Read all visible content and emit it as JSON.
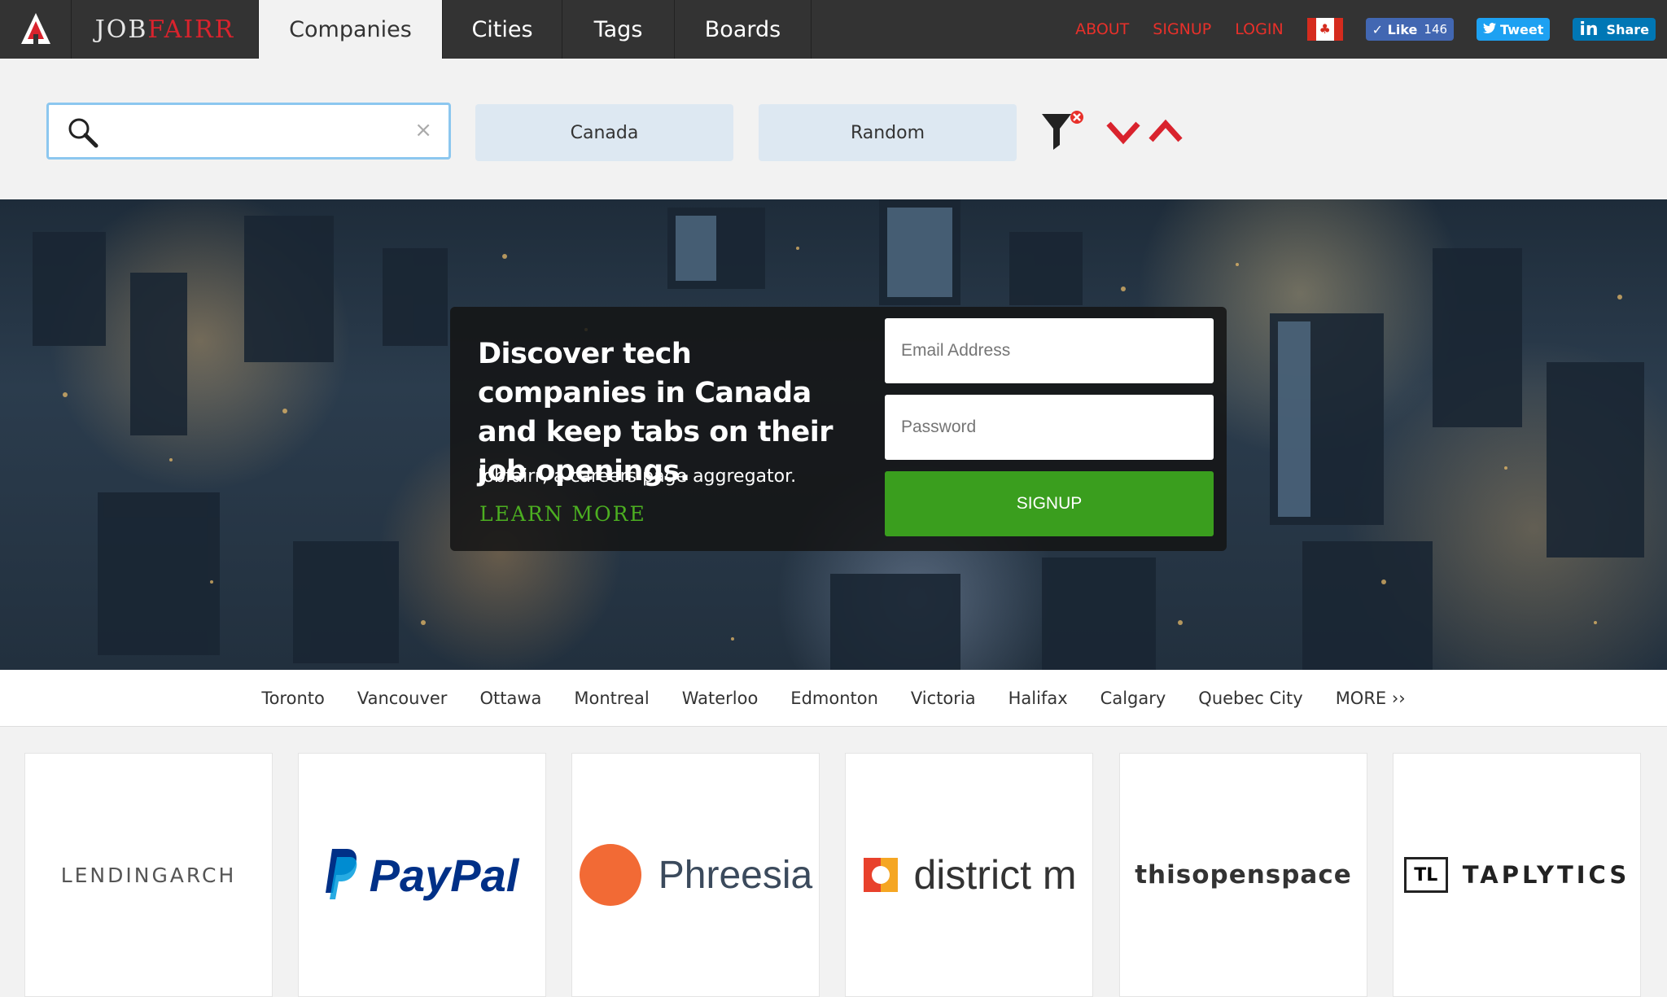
{
  "brand": {
    "part1": "JOB",
    "part2": "FAIRR"
  },
  "nav": {
    "tabs": [
      {
        "label": "Companies",
        "active": true
      },
      {
        "label": "Cities"
      },
      {
        "label": "Tags"
      },
      {
        "label": "Boards"
      }
    ],
    "links": {
      "about": "ABOUT",
      "signup": "SIGNUP",
      "login": "LOGIN"
    },
    "social": {
      "like_label": "Like",
      "like_count": "146",
      "tweet_label": "Tweet",
      "share_label": "Share"
    }
  },
  "filters": {
    "search_value": "",
    "clear": "×",
    "country": "Canada",
    "sort": "Random"
  },
  "hero": {
    "title": "Discover tech companies in Canada and keep tabs on their job openings.",
    "subtitle": "Jobfairr, a careers page aggregator.",
    "learn_more": "LEARN MORE",
    "email_placeholder": "Email Address",
    "password_placeholder": "Password",
    "signup_button": "SIGNUP"
  },
  "cities": [
    "Toronto",
    "Vancouver",
    "Ottawa",
    "Montreal",
    "Waterloo",
    "Edmonton",
    "Victoria",
    "Halifax",
    "Calgary",
    "Quebec City",
    "MORE ››"
  ],
  "companies": [
    {
      "name": "LENDINGARCH"
    },
    {
      "name": "PayPal"
    },
    {
      "name": "Phreesia"
    },
    {
      "name": "district m"
    },
    {
      "name": "thisopenspace"
    },
    {
      "name": "TAPLYTICS",
      "badge": "TL"
    }
  ],
  "colors": {
    "nav_bg": "#333333",
    "accent_red": "#e8302a",
    "signup_green": "#3a9e1e",
    "pill_bg": "#dde8f2",
    "search_border": "#8cc7ef"
  }
}
